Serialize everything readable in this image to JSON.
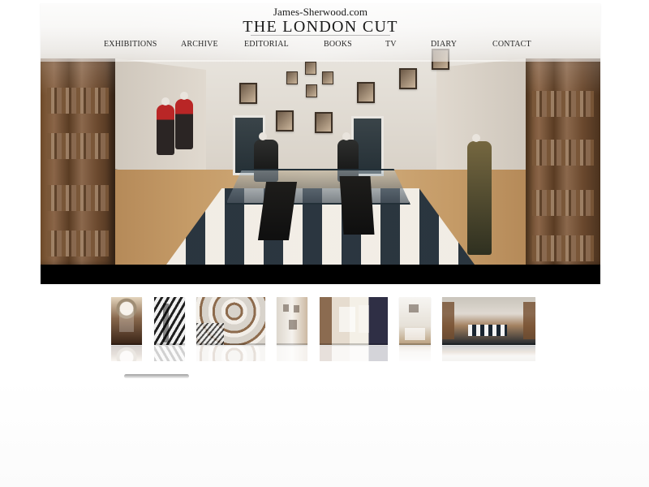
{
  "header": {
    "site": "James-Sherwood.com",
    "title": "THE LONDON CUT"
  },
  "nav": {
    "items": [
      {
        "label": "EXHIBITIONS"
      },
      {
        "label": "ARCHIVE"
      },
      {
        "label": "EDITORIAL"
      },
      {
        "label": "BOOKS"
      },
      {
        "label": "TV"
      },
      {
        "label": "DIARY"
      },
      {
        "label": "CONTACT"
      }
    ]
  },
  "hero": {
    "image": "panoramic-showroom-photo"
  },
  "thumbnails": [
    {
      "image": "staircase-thumbnail"
    },
    {
      "image": "spiral-stair-thumbnail"
    },
    {
      "image": "circular-gallery-thumbnail"
    },
    {
      "image": "interior-thumbnail"
    },
    {
      "image": "books-display-thumbnail"
    },
    {
      "image": "white-room-thumbnail"
    },
    {
      "image": "showroom-thumbnail"
    }
  ],
  "icons": {
    "scroll": "thumbnail-scroll-handle"
  }
}
